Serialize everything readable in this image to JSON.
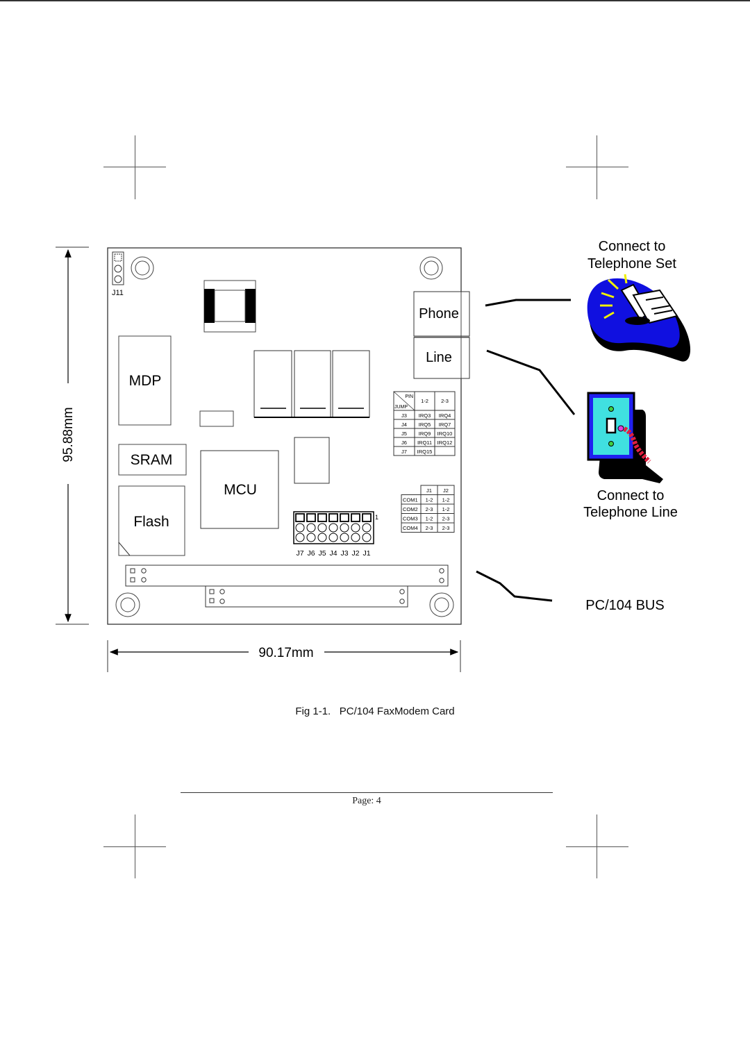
{
  "figure": {
    "board": {
      "chips": {
        "mdp": "MDP",
        "sram": "SRAM",
        "mcu": "MCU",
        "flash": "Flash"
      },
      "jumper_j11_label": "J11",
      "jacks": {
        "phone": "Phone",
        "line": "Line"
      },
      "irq_table": {
        "corner_top": "PIN",
        "corner_bottom": "JUMP",
        "headers": [
          "1-2",
          "2-3"
        ],
        "rows": [
          {
            "jump": "J3",
            "c1": "IRQ3",
            "c2": "IRQ4"
          },
          {
            "jump": "J4",
            "c1": "IRQ5",
            "c2": "IRQ7"
          },
          {
            "jump": "J5",
            "c1": "IRQ9",
            "c2": "IRQ10"
          },
          {
            "jump": "J6",
            "c1": "IRQ11",
            "c2": "IRQ12"
          },
          {
            "jump": "J7",
            "c1": "IRQ15",
            "c2": ""
          }
        ]
      },
      "com_table": {
        "headers": [
          "",
          "J1",
          "J2"
        ],
        "rows": [
          {
            "port": "COM1",
            "j1": "1-2",
            "j2": "1-2"
          },
          {
            "port": "COM2",
            "j1": "2-3",
            "j2": "1-2"
          },
          {
            "port": "COM3",
            "j1": "1-2",
            "j2": "2-3"
          },
          {
            "port": "COM4",
            "j1": "2-3",
            "j2": "2-3"
          }
        ]
      },
      "jumper_block": {
        "pin1_label": "1",
        "labels": [
          "J7",
          "J6",
          "J5",
          "J4",
          "J3",
          "J2",
          "J1"
        ]
      }
    },
    "dimensions": {
      "height": "95.88mm",
      "width": "90.17mm"
    },
    "callouts": {
      "telephone_set": [
        "Connect to",
        "Telephone Set"
      ],
      "telephone_line": [
        "Connect to",
        "Telephone Line"
      ],
      "bus": "PC/104 BUS"
    },
    "colors": {
      "phone_blob": "#1010e0",
      "phone_rays": "#f0f000",
      "wall_plate_face": "#40e0e0",
      "wall_plate_frame": "#2020f0",
      "screw": "#40d040",
      "cord": "#e02040"
    }
  },
  "caption": {
    "fig_no": "Fig 1-1.",
    "title": "PC/104 FaxModem Card"
  },
  "footer": {
    "page": "Page: 4"
  }
}
